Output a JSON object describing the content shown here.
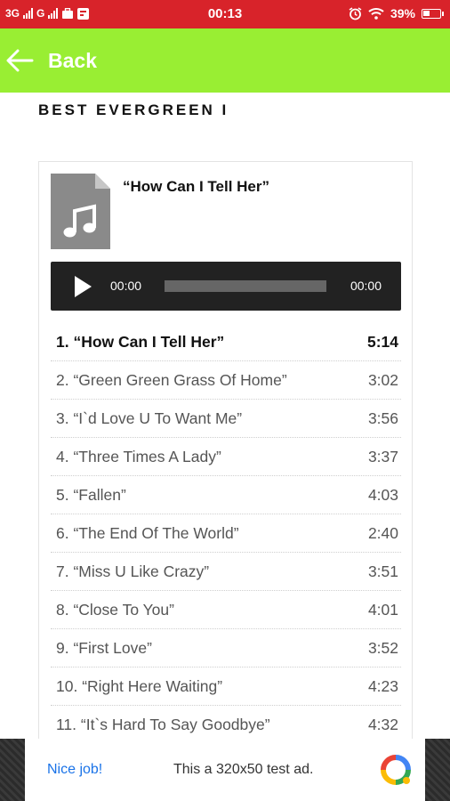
{
  "status_bar": {
    "network_1": "3G",
    "network_2": "G",
    "time": "00:13",
    "battery": "39%",
    "icons": [
      "signal-icon",
      "notification-icon",
      "alarm-icon",
      "wifi-icon",
      "battery-icon"
    ]
  },
  "app_bar": {
    "back_label": "Back",
    "color": "#99ee33"
  },
  "page": {
    "heading": "BEST EVERGREEN I"
  },
  "player": {
    "now_playing": "“How Can I Tell Her”",
    "current_time": "00:00",
    "duration": "00:00"
  },
  "tracks": [
    {
      "title": "1. “How Can I Tell Her”",
      "duration": "5:14"
    },
    {
      "title": "2. “Green Green Grass Of Home”",
      "duration": "3:02"
    },
    {
      "title": "3. “I`d Love U To Want Me”",
      "duration": "3:56"
    },
    {
      "title": "4. “Three Times A Lady”",
      "duration": "3:37"
    },
    {
      "title": "5. “Fallen”",
      "duration": "4:03"
    },
    {
      "title": "6. “The End Of The World”",
      "duration": "2:40"
    },
    {
      "title": "7. “Miss U Like Crazy”",
      "duration": "3:51"
    },
    {
      "title": "8. “Close To You”",
      "duration": "4:01"
    },
    {
      "title": "9. “First Love”",
      "duration": "3:52"
    },
    {
      "title": "10. “Right Here Waiting”",
      "duration": "4:23"
    },
    {
      "title": "11. “It`s Hard To Say Goodbye”",
      "duration": "4:32"
    }
  ],
  "ad": {
    "link_text": "Nice job!",
    "text": "This a 320x50 test ad."
  }
}
